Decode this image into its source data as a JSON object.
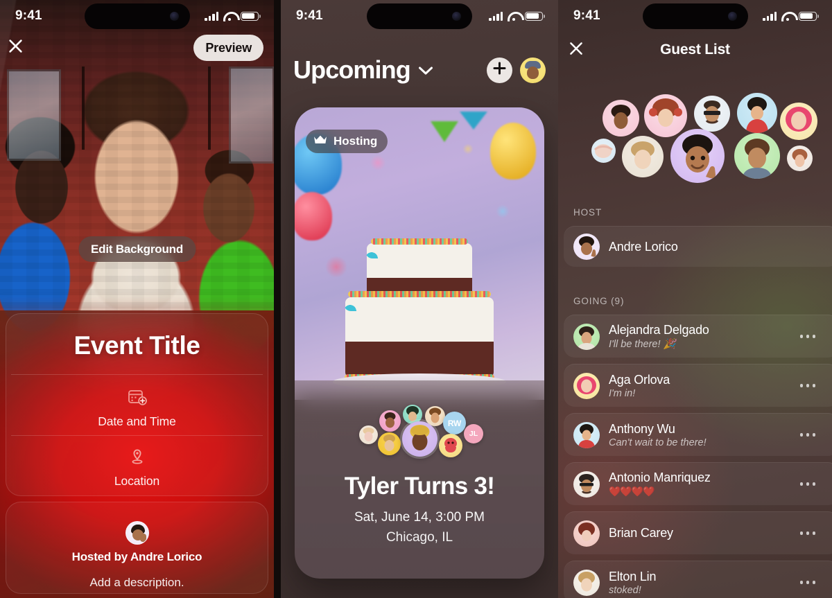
{
  "status_bar": {
    "time": "9:41",
    "signal_icon": "cellular-signal-icon",
    "wifi_icon": "wifi-icon",
    "battery_icon": "battery-icon"
  },
  "left_panel": {
    "close_icon": "close-icon",
    "preview_button": "Preview",
    "edit_background_button": "Edit Background",
    "event_title_placeholder": "Event Title",
    "fields": [
      {
        "icon": "calendar-add-icon",
        "label": "Date and Time"
      },
      {
        "icon": "map-pin-icon",
        "label": "Location"
      }
    ],
    "host_label": "Hosted by Andre Lorico",
    "description_placeholder": "Add a description."
  },
  "middle_panel": {
    "title": "Upcoming",
    "title_chevron_icon": "chevron-down-icon",
    "add_button_icon": "plus-icon",
    "profile_avatar": "user-avatar",
    "badge": {
      "icon": "crown-icon",
      "label": "Hosting"
    },
    "event": {
      "title": "Tyler Turns 3!",
      "datetime": "Sat, June 14, 3:00 PM",
      "location": "Chicago, IL"
    },
    "attendee_initials": [
      "RW",
      "JL"
    ]
  },
  "right_panel": {
    "close_icon": "close-icon",
    "title": "Guest List",
    "sections": [
      {
        "label": "HOST"
      },
      {
        "label": "GOING (9)"
      }
    ],
    "host": {
      "name": "Andre Lorico",
      "reply": ""
    },
    "guests": [
      {
        "name": "Alejandra Delgado",
        "reply": "I'll be there! 🎉",
        "menu_icon": "more-options-icon"
      },
      {
        "name": "Aga Orlova",
        "reply": "I'm in!",
        "menu_icon": "more-options-icon"
      },
      {
        "name": "Anthony Wu",
        "reply": "Can't wait to be there!",
        "menu_icon": "more-options-icon"
      },
      {
        "name": "Antonio Manriquez",
        "reply": "❤️❤️❤️❤️",
        "menu_icon": "more-options-icon"
      },
      {
        "name": "Brian Carey",
        "reply": "",
        "menu_icon": "more-options-icon"
      },
      {
        "name": "Elton Lin",
        "reply": "stoked!",
        "menu_icon": "more-options-icon"
      }
    ]
  },
  "colors": {
    "accent_red": "#e91111",
    "card_surface": "rgba(255,255,255,.055)",
    "preview_pill": "#f3f0ed",
    "badge_bg": "rgba(64,56,54,.62)"
  }
}
